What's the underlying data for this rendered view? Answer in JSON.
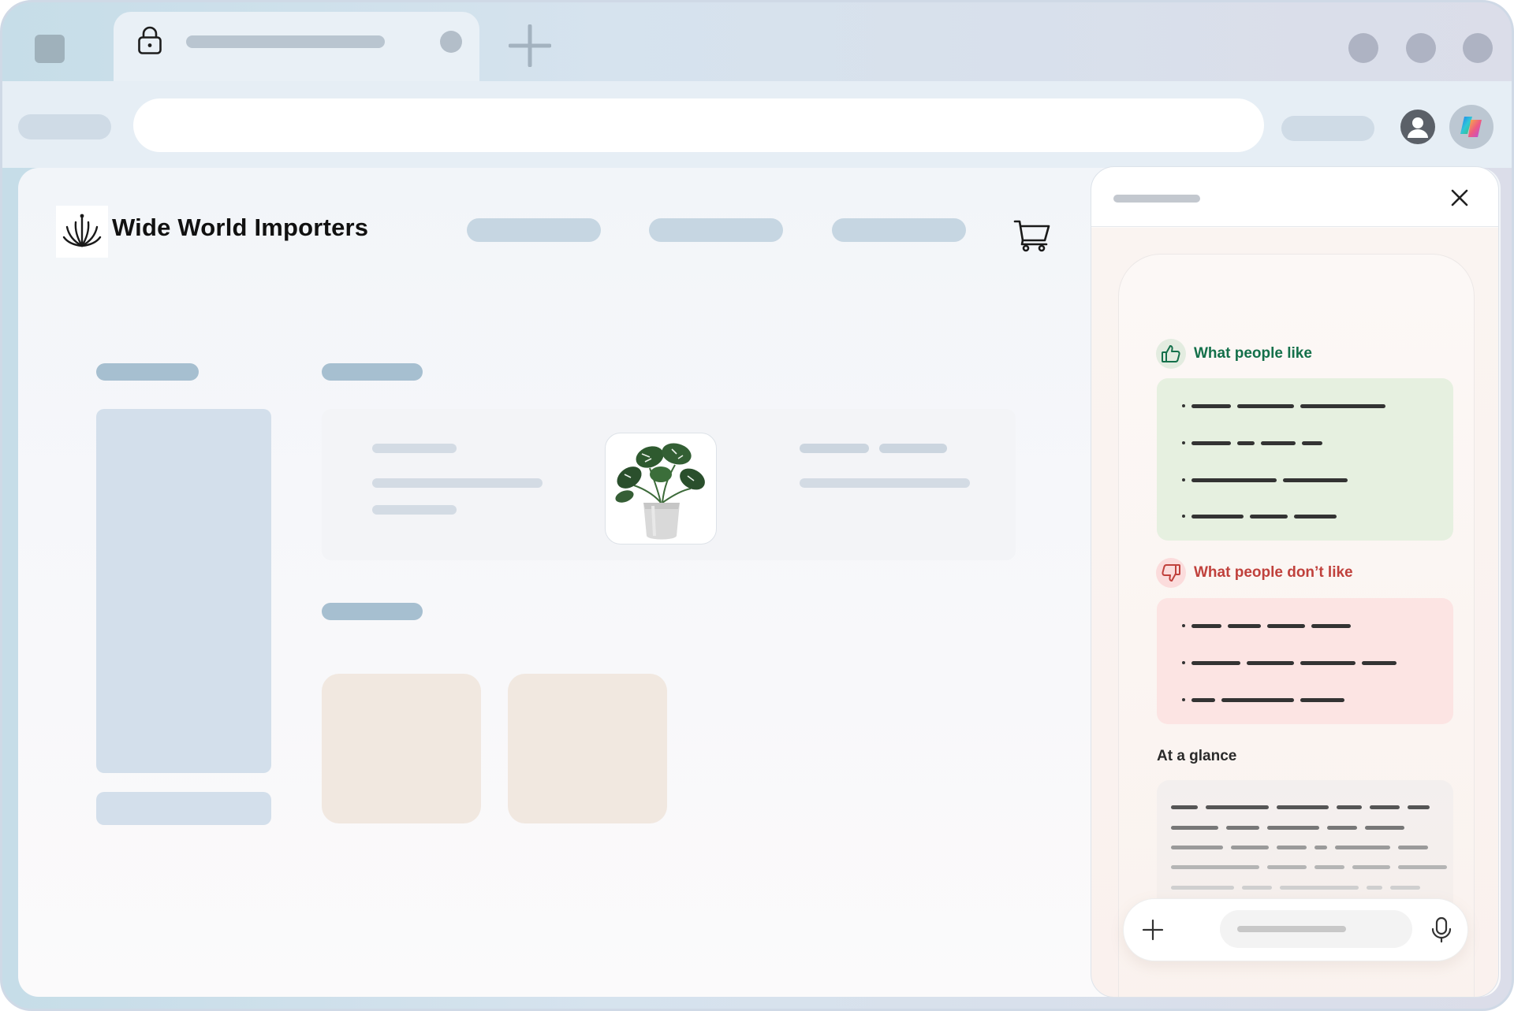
{
  "browser": {
    "tab_icon": "lock-icon",
    "new_tab_icon": "plus-icon",
    "window_controls": [
      "minimize-control",
      "maximize-control",
      "close-control"
    ],
    "profile_icon": "profile-icon",
    "copilot_icon": "copilot-icon"
  },
  "site": {
    "logo_icon": "lotus-logo-icon",
    "name": "Wide World Importers",
    "cart_icon": "cart-icon",
    "product_image": "monstera-plant-in-pot"
  },
  "copilot": {
    "close_icon": "close-icon",
    "likes": {
      "title": "What people like",
      "icon": "thumbs-up-icon",
      "color": "#14704a"
    },
    "dislikes": {
      "title": "What people don’t like",
      "icon": "thumbs-down-icon",
      "color": "#c0413c"
    },
    "glance": {
      "title": "At a glance"
    },
    "composer": {
      "add_icon": "plus-icon",
      "mic_icon": "microphone-icon"
    }
  },
  "colors": {
    "likes_bg": "#e6f0e0",
    "dislikes_bg": "#fce4e3",
    "accent_green": "#14704a",
    "accent_red": "#c0413c"
  }
}
